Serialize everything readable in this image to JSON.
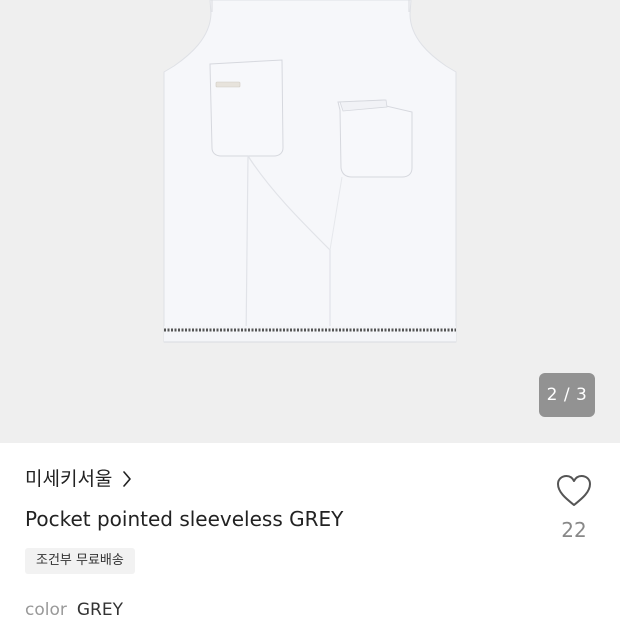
{
  "gallery": {
    "image_alt": "Pocket pointed sleeveless GREY",
    "counter": "2 / 3"
  },
  "product": {
    "brand": "미세키서울",
    "title": "Pocket pointed sleeveless GREY",
    "shipping_badge": "조건부 무료배송",
    "like_count": "22",
    "option_label": "color",
    "option_value": "GREY"
  },
  "colors": {
    "image_background": "#efefef",
    "garment": "#f6f7fa",
    "counter_background": "#6e6e6e",
    "badge_background": "#f2f2f2",
    "text_primary": "#222222",
    "text_muted": "#999999"
  },
  "icons": {
    "brand_link": "chevron-right-icon",
    "like": "heart-outline-icon"
  }
}
